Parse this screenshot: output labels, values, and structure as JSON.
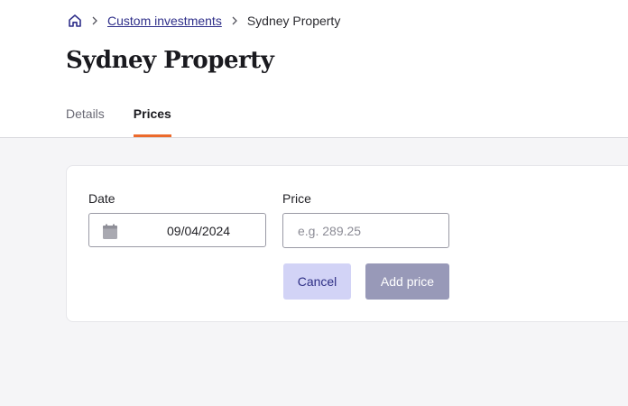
{
  "breadcrumb": {
    "home_icon": "home-icon",
    "separator_icon": "chevron-right-icon",
    "link_label": "Custom investments",
    "current_label": "Sydney Property"
  },
  "page": {
    "title": "Sydney Property"
  },
  "tabs": [
    {
      "label": "Details",
      "active": false
    },
    {
      "label": "Prices",
      "active": true
    }
  ],
  "form": {
    "date": {
      "label": "Date",
      "value": "09/04/2024",
      "icon": "calendar-icon"
    },
    "price": {
      "label": "Price",
      "value": "",
      "placeholder": "e.g. 289.25"
    },
    "cancel_label": "Cancel",
    "add_label": "Add price"
  },
  "colors": {
    "accent_tab_underline": "#ec6a2c",
    "link": "#2f2f8a",
    "cancel_bg": "#d2d3f6",
    "add_bg": "#9899b8",
    "content_bg": "#f5f5f7"
  }
}
